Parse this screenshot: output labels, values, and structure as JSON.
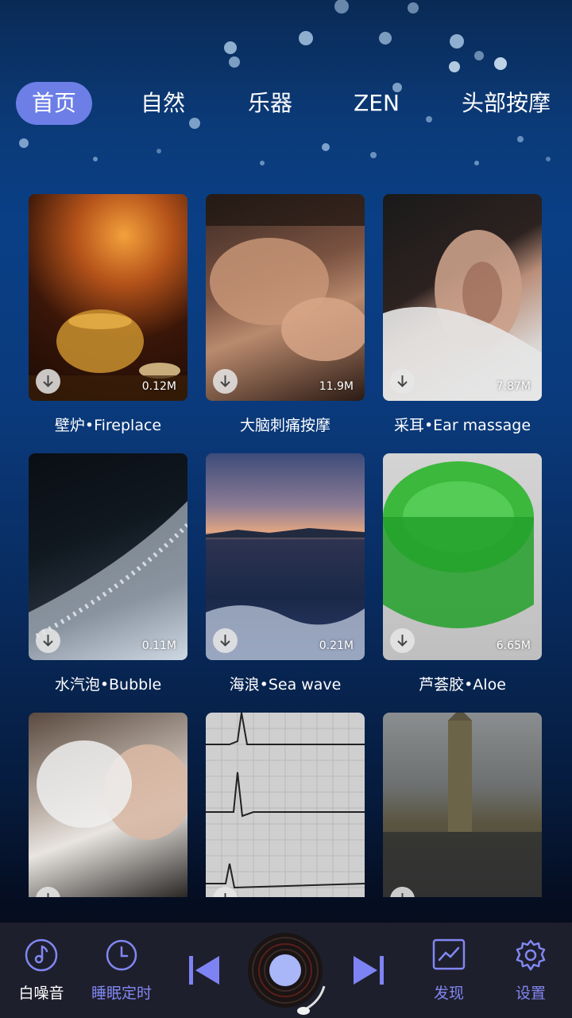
{
  "tabs": [
    {
      "label": "首页"
    },
    {
      "label": "自然"
    },
    {
      "label": "乐器"
    },
    {
      "label": "ZEN"
    },
    {
      "label": "头部按摩"
    }
  ],
  "cards": [
    {
      "title": "壁炉•Fireplace",
      "size": "0.12M",
      "image": "fireplace-teapot"
    },
    {
      "title": "大脑刺痛按摩",
      "size": "11.9M",
      "image": "head-massage"
    },
    {
      "title": "采耳•Ear massage",
      "size": "7.87M",
      "image": "ear-closeup"
    },
    {
      "title": "水汽泡•Bubble",
      "size": "0.11M",
      "image": "bubbles"
    },
    {
      "title": "海浪•Sea wave",
      "size": "0.21M",
      "image": "sea-sunset"
    },
    {
      "title": "芦荟胶•Aloe",
      "size": "6.65M",
      "image": "aloe-gel-jar"
    },
    {
      "title": "",
      "size": "",
      "image": "hair-wash"
    },
    {
      "title": "",
      "size": "",
      "image": "heartbeat-ecg"
    },
    {
      "title": "",
      "size": "",
      "image": "rain-window"
    }
  ],
  "nav": {
    "white_noise": "白噪音",
    "sleep_timer": "睡眠定时",
    "discover": "发现",
    "settings": "设置"
  },
  "colors": {
    "accent": "#6d7fe6",
    "nav_icon": "#8187f2",
    "bottom_bar": "#1e1f2c"
  }
}
